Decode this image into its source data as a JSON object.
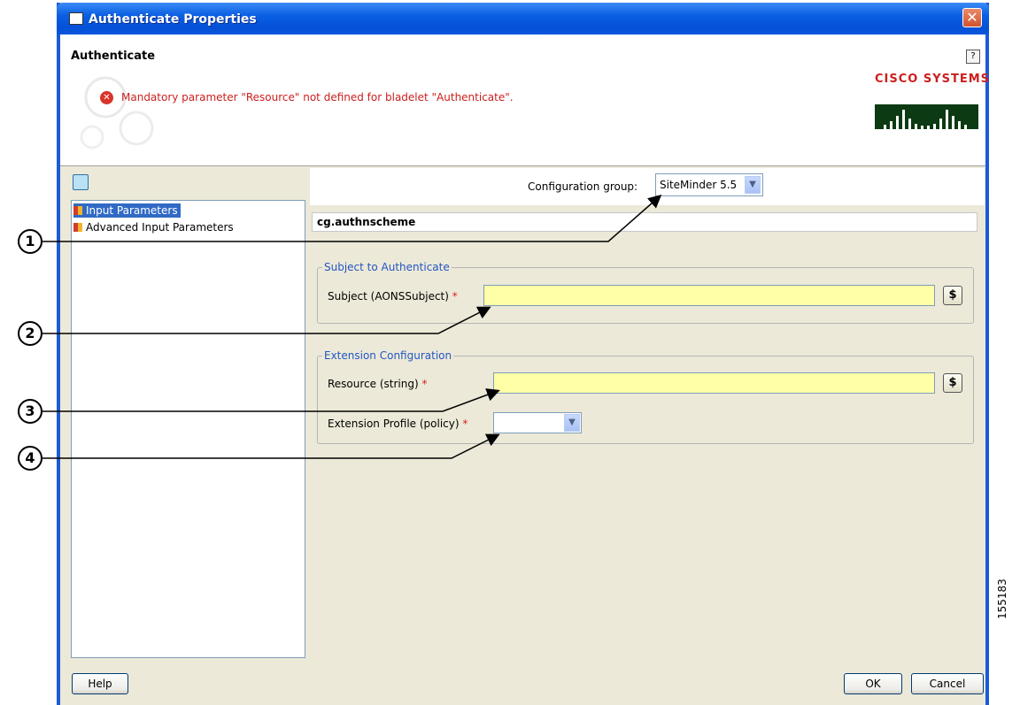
{
  "window": {
    "title": "Authenticate Properties",
    "close_label": "✕"
  },
  "header": {
    "title": "Authenticate",
    "help_label": "?",
    "error_message": "Mandatory parameter \"Resource\" not defined for bladelet \"Authenticate\".",
    "brand": "CISCO SYSTEMS"
  },
  "tree": {
    "items": [
      {
        "label": "Input Parameters",
        "selected": true
      },
      {
        "label": "Advanced Input Parameters",
        "selected": false
      }
    ]
  },
  "config": {
    "label": "Configuration group:",
    "selected": "SiteMinder 5.5",
    "name": "cg.authnscheme"
  },
  "subject_group": {
    "legend": "Subject to Authenticate",
    "field_label": "Subject (AONSSubject)",
    "required_mark": "*",
    "value": "",
    "dollar": "$"
  },
  "extension_group": {
    "legend": "Extension Configuration",
    "resource_label": "Resource (string)",
    "resource_value": "",
    "profile_label": "Extension Profile (policy)",
    "profile_value": "",
    "required_mark": "*",
    "dollar": "$"
  },
  "buttons": {
    "help": "Help",
    "ok": "OK",
    "cancel": "Cancel"
  },
  "callouts": [
    "1",
    "2",
    "3",
    "4"
  ],
  "figure_number": "155183",
  "colors": {
    "titlebar": "#0a5fe3",
    "error": "#cc1f1f",
    "required_field": "#ffffa8",
    "selection": "#316ac5"
  }
}
